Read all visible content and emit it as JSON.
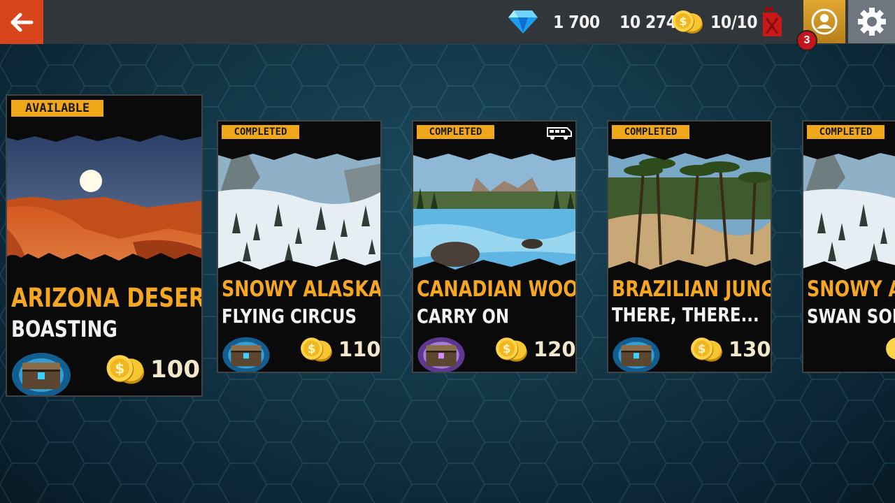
{
  "header": {
    "back_icon": "arrow-left-icon",
    "gems": "1 700",
    "coins": "10 274",
    "fuel": "10/10",
    "notification_count": "3",
    "icons": {
      "gem": "diamond-icon",
      "coin": "coin-icon",
      "fuel": "fuel-can-icon",
      "profile": "user-icon",
      "settings": "gear-icon"
    }
  },
  "colors": {
    "accent_orange": "#d8441c",
    "status_yellow": "#f0a81a",
    "title_gold": "#f5a623",
    "profile_gold": "#d19a28"
  },
  "missions": [
    {
      "status": "AVAILABLE",
      "region": "ARIZONA DESERT",
      "name": "BOASTING",
      "reward": "100",
      "chest": "blue"
    },
    {
      "status": "COMPLETED",
      "region": "SNOWY ALASKA",
      "name": "FLYING CIRCUS",
      "reward": "110",
      "chest": "blue"
    },
    {
      "status": "COMPLETED",
      "region": "CANADIAN WOODS",
      "name": "CARRY ON",
      "reward": "120",
      "chest": "purple",
      "vehicle_icon": "bus-icon"
    },
    {
      "status": "COMPLETED",
      "region": "BRAZILIAN JUNGLE",
      "name": "THERE, THERE...",
      "reward": "130",
      "chest": "blue"
    },
    {
      "status": "COMPLETED",
      "region": "SNOWY ALA",
      "name": "SWAN SONG",
      "reward": "",
      "chest": "blue"
    }
  ]
}
